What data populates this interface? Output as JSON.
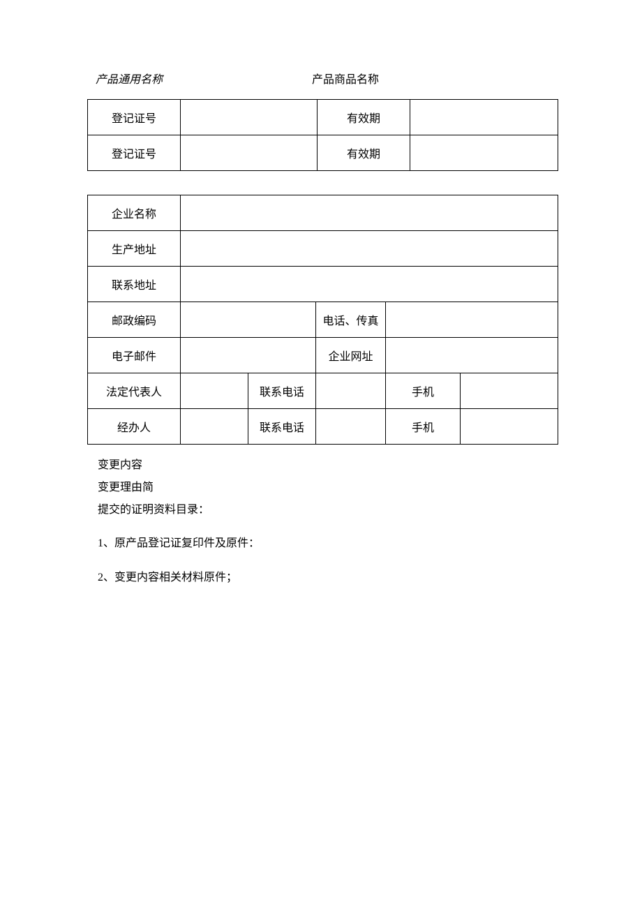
{
  "header": {
    "generic_name_label": "产品通用名称",
    "trade_name_label": "产品商品名称"
  },
  "table1": {
    "rows": [
      {
        "label1": "登记证号",
        "value1": "",
        "label2": "有效期",
        "value2": ""
      },
      {
        "label1": "登记证号",
        "value1": "",
        "label2": "有效期",
        "value2": ""
      }
    ]
  },
  "table2": {
    "company_name_label": "企业名称",
    "company_name_value": "",
    "production_address_label": "生产地址",
    "production_address_value": "",
    "contact_address_label": "联系地址",
    "contact_address_value": "",
    "postal_code_label": "邮政编码",
    "postal_code_value": "",
    "phone_fax_label": "电话、传真",
    "phone_fax_value": "",
    "email_label": "电子邮件",
    "email_value": "",
    "website_label": "企业网址",
    "website_value": "",
    "legal_rep_label": "法定代表人",
    "legal_rep_value": "",
    "legal_phone_label": "联系电话",
    "legal_phone_value": "",
    "legal_mobile_label": "手机",
    "legal_mobile_value": "",
    "handler_label": "经办人",
    "handler_value": "",
    "handler_phone_label": "联系电话",
    "handler_phone_value": "",
    "handler_mobile_label": "手机",
    "handler_mobile_value": ""
  },
  "text": {
    "change_content": "变更内容",
    "change_reason": "变更理由简",
    "materials_title": "提交的证明资料目录：",
    "item1": "1、原产品登记证复印件及原件：",
    "item2": "2、变更内容相关材料原件；"
  }
}
